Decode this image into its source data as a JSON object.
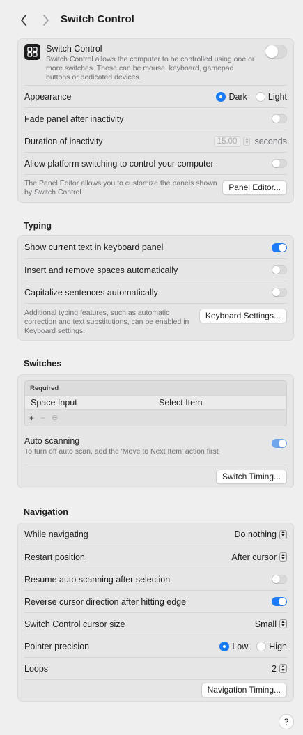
{
  "toolbar": {
    "title": "Switch Control",
    "back_icon": "chevron-left-icon",
    "forward_icon": "chevron-right-icon"
  },
  "general": {
    "header": {
      "title": "Switch Control",
      "description": "Switch Control allows the computer to be controlled using one or more switches. These can be mouse, keyboard, gamepad buttons or dedicated devices.",
      "enabled": false
    },
    "appearance": {
      "label": "Appearance",
      "options": [
        "Dark",
        "Light"
      ],
      "selected": "Dark"
    },
    "fade_panel": {
      "label": "Fade panel after inactivity",
      "enabled": false
    },
    "duration": {
      "label": "Duration of inactivity",
      "value": "15.00",
      "unit": "seconds"
    },
    "platform_switching": {
      "label": "Allow platform switching to control your computer",
      "enabled": false
    },
    "panel_editor": {
      "description": "The Panel Editor allows you to customize the panels shown by Switch Control.",
      "button": "Panel Editor..."
    }
  },
  "typing": {
    "title": "Typing",
    "show_text": {
      "label": "Show current text in keyboard panel",
      "enabled": true
    },
    "spaces": {
      "label": "Insert and remove spaces automatically",
      "enabled": false
    },
    "capitalize": {
      "label": "Capitalize sentences automatically",
      "enabled": false
    },
    "keyboard_settings": {
      "description": "Additional typing features, such as automatic correction and text substitutions, can be enabled in Keyboard settings.",
      "button": "Keyboard Settings..."
    }
  },
  "switches": {
    "title": "Switches",
    "table": {
      "group": "Required",
      "rows": [
        {
          "input": "Space Input",
          "action": "Select Item"
        }
      ],
      "tools": [
        "+",
        "−",
        "⊖"
      ]
    },
    "auto_scanning": {
      "label": "Auto scanning",
      "description": "To turn off auto scan, add the 'Move to Next Item' action first",
      "enabled": true
    },
    "timing_button": "Switch Timing..."
  },
  "navigation": {
    "title": "Navigation",
    "while_navigating": {
      "label": "While navigating",
      "value": "Do nothing"
    },
    "restart_position": {
      "label": "Restart position",
      "value": "After cursor"
    },
    "resume_scanning": {
      "label": "Resume auto scanning after selection",
      "enabled": false
    },
    "reverse_direction": {
      "label": "Reverse cursor direction after hitting edge",
      "enabled": true
    },
    "cursor_size": {
      "label": "Switch Control cursor size",
      "value": "Small"
    },
    "pointer_precision": {
      "label": "Pointer precision",
      "options": [
        "Low",
        "High"
      ],
      "selected": "Low"
    },
    "loops": {
      "label": "Loops",
      "value": "2"
    },
    "timing_button": "Navigation Timing..."
  },
  "help": {
    "label": "?"
  }
}
